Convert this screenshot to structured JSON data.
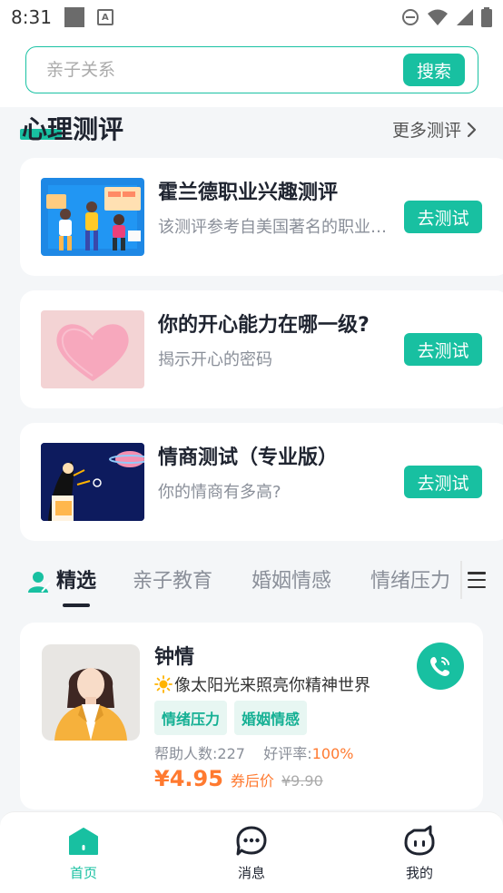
{
  "status_bar": {
    "time": "8:31",
    "notification_icons": [
      "square-icon",
      "a-icon"
    ],
    "system_icons": [
      "dnd-icon",
      "wifi-icon",
      "signal-icon",
      "battery-icon"
    ]
  },
  "search": {
    "placeholder": "亲子关系",
    "button_label": "搜索"
  },
  "section": {
    "title": "心理测评",
    "more_label": "更多测评"
  },
  "tests": [
    {
      "title": "霍兰德职业兴趣测评",
      "desc": "该测评参考自美国著名的职业指导专家",
      "button": "去测试"
    },
    {
      "title": "你的开心能力在哪一级?",
      "desc": "揭示开心的密码",
      "button": "去测试"
    },
    {
      "title": "情商测试（专业版）",
      "desc": "你的情商有多高?",
      "button": "去测试"
    }
  ],
  "tabs": {
    "items": [
      "精选",
      "亲子教育",
      "婚姻情感",
      "情绪压力"
    ],
    "active_index": 0
  },
  "counselor": {
    "name": "钟情",
    "motto": "像太阳光来照亮你精神世界",
    "tags": [
      "情绪压力",
      "婚姻情感"
    ],
    "helped_label": "帮助人数:",
    "helped_count": "227",
    "rating_label": "好评率:",
    "rating_value": "100%",
    "price_now": "¥4.95",
    "price_tag": "券后价",
    "price_old": "¥9.90"
  },
  "bottom_nav": {
    "items": [
      {
        "label": "首页",
        "icon": "home-icon",
        "active": true
      },
      {
        "label": "消息",
        "icon": "message-icon",
        "active": false
      },
      {
        "label": "我的",
        "icon": "profile-icon",
        "active": false
      }
    ]
  },
  "colors": {
    "accent": "#18c0a1",
    "price": "#ff7a30",
    "text_dark": "#1f2430",
    "text_muted": "#8a8f99"
  }
}
